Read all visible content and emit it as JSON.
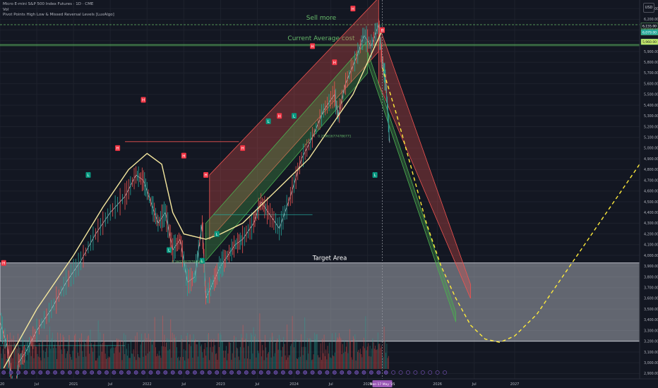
{
  "legend": {
    "symbol_line": "Micro E-mini S&P 500 Index Futures · 1D · CME",
    "indicator_vol": "Vol",
    "indicator_pivot": "Pivot Points High Low & Missed Reversal Levels [LuxAlgo]"
  },
  "currency_button": "USD",
  "chart_data": {
    "type": "line",
    "title": "",
    "xlabel": "",
    "ylabel": "",
    "x_ticks": [
      "2020",
      "Jul",
      "2021",
      "Jul",
      "2022",
      "Jul",
      "2023",
      "Jul",
      "2024",
      "Jul",
      "2025",
      "2026",
      "Jul",
      "2027"
    ],
    "y_ticks": [
      6300,
      6200,
      6100,
      6000,
      5900,
      5800,
      5700,
      5600,
      5500,
      5400,
      5300,
      5200,
      5100,
      5000,
      4900,
      4800,
      4700,
      4600,
      4500,
      4400,
      4300,
      4200,
      4100,
      4000,
      3900,
      3800,
      3700,
      3600,
      3500,
      3400,
      3300,
      3200,
      3100,
      3000,
      2900
    ],
    "ylim": [
      2850,
      6380
    ],
    "xlim": [
      2020.0,
      2028.7
    ],
    "price_series": {
      "name": "",
      "x": [
        2020.0,
        2020.1,
        2020.2,
        2020.25,
        2020.35,
        2020.5,
        2020.7,
        2020.9,
        2021.1,
        2021.3,
        2021.5,
        2021.7,
        2021.85,
        2021.95,
        2022.05,
        2022.15,
        2022.25,
        2022.35,
        2022.45,
        2022.55,
        2022.65,
        2022.75,
        2022.8,
        2022.9,
        2023.0,
        2023.1,
        2023.2,
        2023.3,
        2023.45,
        2023.55,
        2023.65,
        2023.8,
        2023.95,
        2024.1,
        2024.25,
        2024.4,
        2024.55,
        2024.6,
        2024.7,
        2024.85,
        2024.95,
        2025.05,
        2025.15,
        2025.2,
        2025.25,
        2025.3
      ],
      "y": [
        3380,
        3150,
        2600,
        3000,
        3100,
        3300,
        3500,
        3750,
        3950,
        4200,
        4400,
        4550,
        4750,
        4700,
        4500,
        4300,
        4400,
        4050,
        4150,
        3750,
        3800,
        4300,
        3600,
        3750,
        3900,
        4000,
        4100,
        4150,
        4300,
        4500,
        4400,
        4250,
        4550,
        4900,
        5100,
        5350,
        5500,
        5300,
        5600,
        5850,
        6050,
        5950,
        6150,
        5800,
        5600,
        5050
      ]
    },
    "series": [
      {
        "name": "",
        "x": [
          2020.05,
          2020.5,
          2021.0,
          2021.4,
          2021.75,
          2022.0,
          2022.2,
          2022.35,
          2022.5,
          2022.8,
          2023.0,
          2023.3,
          2023.6,
          2023.9,
          2024.2,
          2024.5,
          2024.8,
          2025.0,
          2025.2
        ],
        "y": [
          2950,
          3500,
          4000,
          4450,
          4800,
          4950,
          4850,
          4400,
          4200,
          4150,
          4200,
          4300,
          4500,
          4700,
          4900,
          5200,
          5500,
          5800,
          6100
        ]
      },
      {
        "name": "",
        "x": [
          2025.2,
          2025.4,
          2025.6,
          2025.8,
          2026.0,
          2026.2,
          2026.4,
          2026.6,
          2026.8,
          2027.0,
          2027.3,
          2027.6,
          2027.9,
          2028.2,
          2028.45,
          2028.65,
          2028.8,
          2028.95,
          2029.1,
          2029.3,
          2029.5,
          2029.7,
          2029.9,
          2030.1,
          2030.3
        ],
        "y": [
          5750,
          5300,
          4800,
          4300,
          3900,
          3600,
          3350,
          3220,
          3190,
          3250,
          3450,
          3750,
          4050,
          4350,
          4600,
          4800,
          4950,
          5020,
          5030,
          4980,
          4900,
          4800,
          4700,
          4600,
          4500
        ]
      }
    ],
    "regions": [
      {
        "label": "Sell more",
        "y": 6150,
        "style": "dashed-line"
      },
      {
        "label": "Current Average cost",
        "y": 5960,
        "style": "band"
      },
      {
        "label": "Target Area",
        "y_range": [
          3200,
          3930
        ],
        "style": "box"
      }
    ],
    "channels": [
      {
        "color": "red",
        "from_x": 2022.85,
        "to_x": 2025.15,
        "low_y": [
          4150,
          5900
        ],
        "high_y": [
          4750,
          6400
        ]
      },
      {
        "color": "green",
        "from_x": 2022.8,
        "to_x": 2025.0,
        "low_y": [
          3950,
          5700
        ],
        "high_y": [
          4300,
          6000
        ]
      },
      {
        "color": "red",
        "from_x": 2025.15,
        "to_x": 2026.4,
        "low_y": [
          5600,
          3600
        ],
        "high_y": [
          6150,
          3730
        ]
      },
      {
        "color": "green",
        "from_x": 2025.0,
        "to_x": 2026.2,
        "low_y": [
          5800,
          3380
        ],
        "high_y": [
          5900,
          3470
        ]
      }
    ],
    "pivot_labels": [
      {
        "x": 2020.05,
        "y": 3930,
        "text": "H",
        "kind": "high"
      },
      {
        "x": 2021.6,
        "y": 5000,
        "text": "H",
        "kind": "high"
      },
      {
        "x": 2021.95,
        "y": 5450,
        "text": "H",
        "kind": "high"
      },
      {
        "x": 2022.5,
        "y": 4930,
        "text": "H",
        "kind": "high"
      },
      {
        "x": 2022.8,
        "y": 4750,
        "text": "H",
        "kind": "high"
      },
      {
        "x": 2023.3,
        "y": 5000,
        "text": "H",
        "kind": "high"
      },
      {
        "x": 2023.8,
        "y": 5300,
        "text": "H",
        "kind": "high"
      },
      {
        "x": 2024.25,
        "y": 5950,
        "text": "H",
        "kind": "high"
      },
      {
        "x": 2024.55,
        "y": 5800,
        "text": "H",
        "kind": "high"
      },
      {
        "x": 2024.8,
        "y": 6300,
        "text": "H",
        "kind": "high"
      },
      {
        "x": 2025.2,
        "y": 6100,
        "text": "H",
        "kind": "high"
      },
      {
        "x": 2021.2,
        "y": 4750,
        "text": "L",
        "kind": "low"
      },
      {
        "x": 2022.3,
        "y": 4050,
        "text": "L",
        "kind": "low"
      },
      {
        "x": 2022.75,
        "y": 3950,
        "text": "L",
        "kind": "low"
      },
      {
        "x": 2022.95,
        "y": 4200,
        "text": "L",
        "kind": "low"
      },
      {
        "x": 2023.65,
        "y": 5250,
        "text": "L",
        "kind": "low"
      },
      {
        "x": 2024.0,
        "y": 5300,
        "text": "L",
        "kind": "low"
      },
      {
        "x": 2025.1,
        "y": 4750,
        "text": "L",
        "kind": "low"
      }
    ],
    "annotations": [
      {
        "x": 2022.55,
        "y": 3930,
        "text": "0.36024879784865"
      },
      {
        "x": 2024.55,
        "y": 5100,
        "text": "0.219616774786771"
      }
    ],
    "price_tags": [
      {
        "y": 6140,
        "text": "6,155.00"
      },
      {
        "y": 6080,
        "text": "6,079.00"
      },
      {
        "y": 5990,
        "text": "5,960.00"
      }
    ],
    "cursor_label": "Mon 17 May '25",
    "grid": true
  }
}
